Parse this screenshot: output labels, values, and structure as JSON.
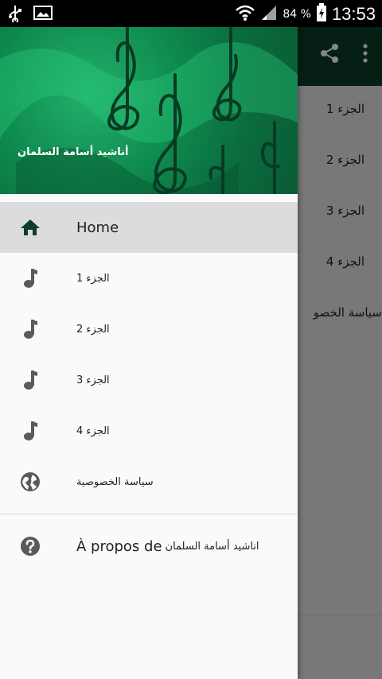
{
  "status_bar": {
    "battery_percent": "84 %",
    "time": "13:53",
    "icons": [
      "usb-icon",
      "image-icon",
      "wifi-icon",
      "signal-icon",
      "battery-charging-icon"
    ]
  },
  "app": {
    "list_items": [
      "الجزء 1",
      "الجزء 2",
      "الجزء 3",
      "الجزء 4",
      "سياسة الخصو"
    ]
  },
  "drawer": {
    "header_title": "أناشيد أسامة السلمان",
    "menu": [
      {
        "label": "Home",
        "icon": "home-icon",
        "active": true
      },
      {
        "label": "الجزء 1",
        "icon": "music-note-icon",
        "active": false
      },
      {
        "label": "الجزء 2",
        "icon": "music-note-icon",
        "active": false
      },
      {
        "label": "الجزء 3",
        "icon": "music-note-icon",
        "active": false
      },
      {
        "label": "الجزء 4",
        "icon": "music-note-icon",
        "active": false
      },
      {
        "label": "سياسة الخصوصية",
        "icon": "globe-icon",
        "active": false
      }
    ],
    "about": {
      "prefix": "À propos de",
      "name": "اناشيد أسامة السلمان",
      "icon": "help-icon"
    }
  },
  "colors": {
    "primary_dark": "#0b3d2a",
    "header_green": "#0e8a4e",
    "active_row": "#dcdcdc"
  }
}
